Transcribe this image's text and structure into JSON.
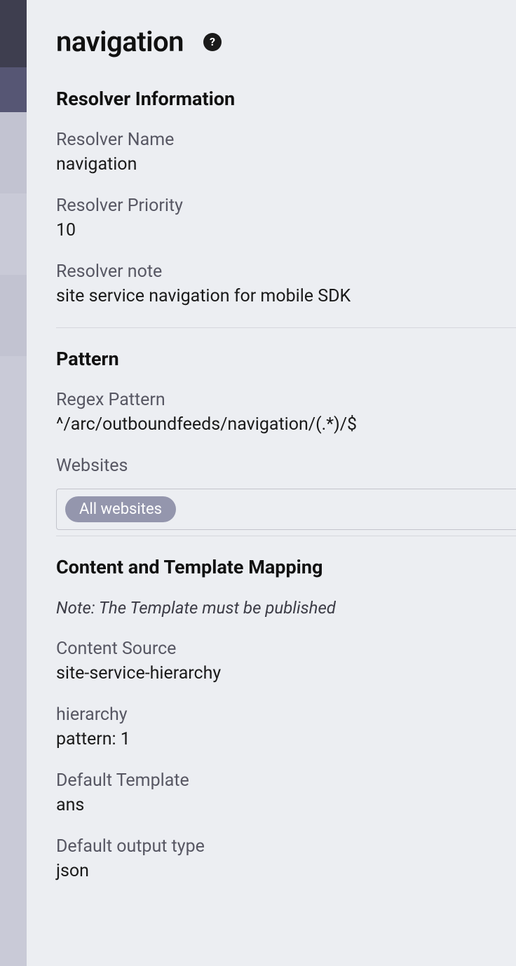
{
  "title": "navigation",
  "help_icon_name": "help-icon",
  "sections": {
    "resolver_info": {
      "heading": "Resolver Information",
      "name": {
        "label": "Resolver Name",
        "value": "navigation"
      },
      "priority": {
        "label": "Resolver Priority",
        "value": "10"
      },
      "note": {
        "label": "Resolver note",
        "value": "site service navigation for mobile SDK"
      }
    },
    "pattern": {
      "heading": "Pattern",
      "regex": {
        "label": "Regex Pattern",
        "value": "^/arc/outboundfeeds/navigation/(.*)/$"
      },
      "websites": {
        "label": "Websites",
        "chip": "All websites"
      }
    },
    "mapping": {
      "heading": "Content and Template Mapping",
      "note": "Note: The Template must be published",
      "content_source": {
        "label": "Content Source",
        "value": "site-service-hierarchy"
      },
      "hierarchy": {
        "label": "hierarchy",
        "value": "pattern: 1"
      },
      "template": {
        "label": "Default Template",
        "value": "ans"
      },
      "output": {
        "label": "Default output type",
        "value": "json"
      }
    }
  }
}
